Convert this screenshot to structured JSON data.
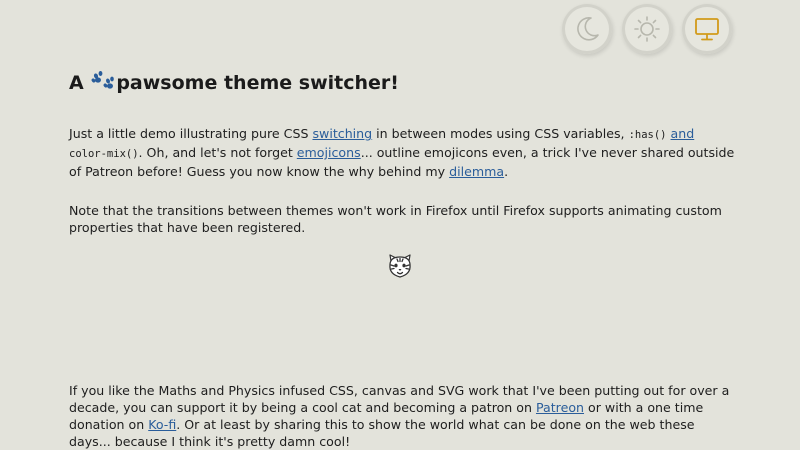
{
  "theme_switcher": {
    "options": [
      {
        "name": "dark",
        "icon": "moon-icon"
      },
      {
        "name": "light",
        "icon": "sun-icon"
      },
      {
        "name": "system",
        "icon": "monitor-icon",
        "color": "#d29a1a"
      }
    ],
    "icon_color": "#b7b7ad"
  },
  "header": {
    "title_prefix": "A ",
    "paw_emoji": "🐾",
    "title_suffix": "pawsome theme switcher!"
  },
  "intro": {
    "t1": "Just a little demo illustrating pure CSS ",
    "link_switching": "switching",
    "t2": " in between modes using CSS variables, ",
    "code_has": ":has()",
    "t3": " ",
    "link_and": "and",
    "t4": " ",
    "code_color_mix": "color-mix()",
    "t5": ". Oh, and let's not forget ",
    "link_emojicons": "emojicons",
    "t6": "... outline emojicons even, a trick I've never shared outside of Patreon before! Guess you now know the why behind my ",
    "link_dilemma": "dilemma",
    "t7": "."
  },
  "note": {
    "text": "Note that the transitions between themes won't work in Firefox until Firefox supports animating custom properties that have been registered."
  },
  "cat_emoji": "tiger-face-icon",
  "support": {
    "t1": "If you like the Maths and Physics infused CSS, canvas and SVG work that I've been putting out for over a decade, you can support it by being a cool cat and becoming a patron on ",
    "link_patreon": "Patreon",
    "t2": " or with a one time donation on ",
    "link_kofi": "Ko-fi",
    "t3": ". Or at least by sharing this to show the world what can be done on the web these days... because I think it's pretty damn cool!"
  },
  "colors": {
    "background": "#e3e3db",
    "text": "#1e1e1e",
    "link": "#2a5d9a",
    "paw": "#2a5d9a"
  }
}
